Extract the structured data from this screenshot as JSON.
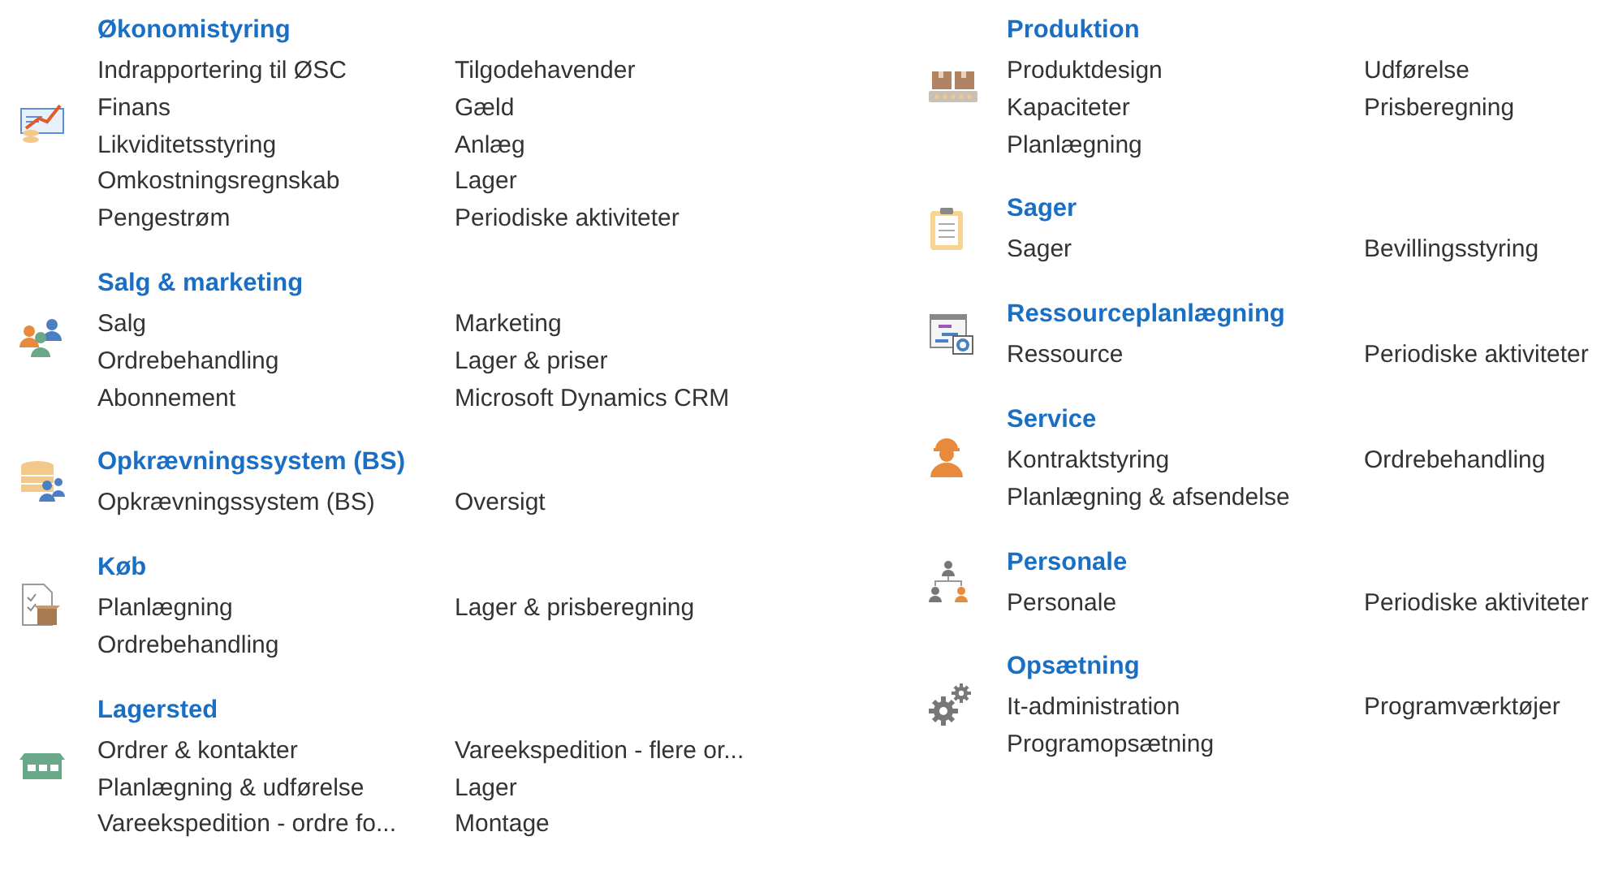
{
  "left_column": [
    {
      "title": "Økonomistyring",
      "links_column_1": [
        "Indrapportering til ØSC",
        "Finans",
        "Likviditetsstyring",
        "Omkostningsregnskab",
        "Pengestrøm"
      ],
      "links_column_2": [
        "Tilgodehavender",
        "Gæld",
        "Anlæg",
        "Lager",
        "Periodiske aktiviteter"
      ]
    },
    {
      "title": "Salg & marketing",
      "links_column_1": [
        "Salg",
        "Ordrebehandling",
        "Abonnement"
      ],
      "links_column_2": [
        "Marketing",
        "Lager & priser",
        "Microsoft Dynamics CRM"
      ]
    },
    {
      "title": "Opkrævningssystem (BS)",
      "links_column_1": [
        "Opkrævningssystem (BS)"
      ],
      "links_column_2": [
        "Oversigt"
      ]
    },
    {
      "title": "Køb",
      "links_column_1": [
        "Planlægning",
        "Ordrebehandling"
      ],
      "links_column_2": [
        "Lager & prisberegning"
      ]
    },
    {
      "title": "Lagersted",
      "links_column_1": [
        "Ordrer & kontakter",
        "Planlægning & udførelse",
        "Vareekspedition - ordre fo..."
      ],
      "links_column_2": [
        "Vareekspedition - flere or...",
        "Lager",
        "Montage"
      ]
    }
  ],
  "right_column": [
    {
      "title": "Produktion",
      "links_column_1": [
        "Produktdesign",
        "Kapaciteter",
        "Planlægning"
      ],
      "links_column_2": [
        "Udførelse",
        "Prisberegning"
      ]
    },
    {
      "title": "Sager",
      "links_column_1": [
        "Sager"
      ],
      "links_column_2": [
        "Bevillingsstyring"
      ]
    },
    {
      "title": "Ressourceplanlægning",
      "links_column_1": [
        "Ressource"
      ],
      "links_column_2": [
        "Periodiske aktiviteter"
      ]
    },
    {
      "title": "Service",
      "links_column_1": [
        "Kontraktstyring",
        "Planlægning & afsendelse"
      ],
      "links_column_2": [
        "Ordrebehandling"
      ]
    },
    {
      "title": "Personale",
      "links_column_1": [
        "Personale"
      ],
      "links_column_2": [
        "Periodiske aktiviteter"
      ]
    },
    {
      "title": "Opsætning",
      "links_column_1": [
        "It-administration",
        "Programopsætning"
      ],
      "links_column_2": [
        "Programværktøjer"
      ]
    }
  ]
}
